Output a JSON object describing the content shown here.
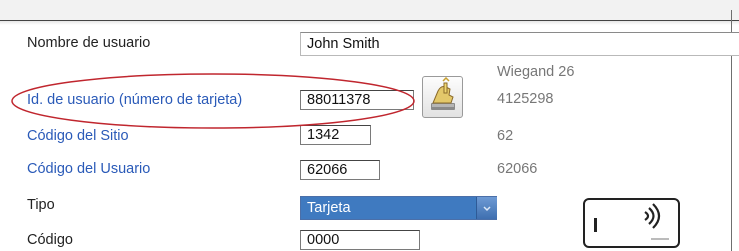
{
  "form": {
    "username": {
      "label": "Nombre de usuario",
      "value": "John Smith"
    },
    "user_id": {
      "label": "Id. de usuario (número de tarjeta)",
      "value": "88011378"
    },
    "site_code": {
      "label": "Código del Sitio",
      "value": "1342"
    },
    "user_code": {
      "label": "Código del Usuario",
      "value": "62066"
    },
    "type": {
      "label": "Tipo",
      "value": "Tarjeta"
    },
    "code": {
      "label": "Código",
      "value": "0000"
    }
  },
  "wiegand": {
    "title": "Wiegand 26",
    "user_id": "4125298",
    "site_code": "62",
    "user_code": "62066"
  },
  "icons": {
    "read_button": "card-reader-hand-icon",
    "card": "contactless-card-icon",
    "dropdown": "chevron-down-icon"
  },
  "colors": {
    "highlight_oval": "#c0262e",
    "link_label": "#2a5ab8",
    "select_bg": "#3f7ac0"
  }
}
